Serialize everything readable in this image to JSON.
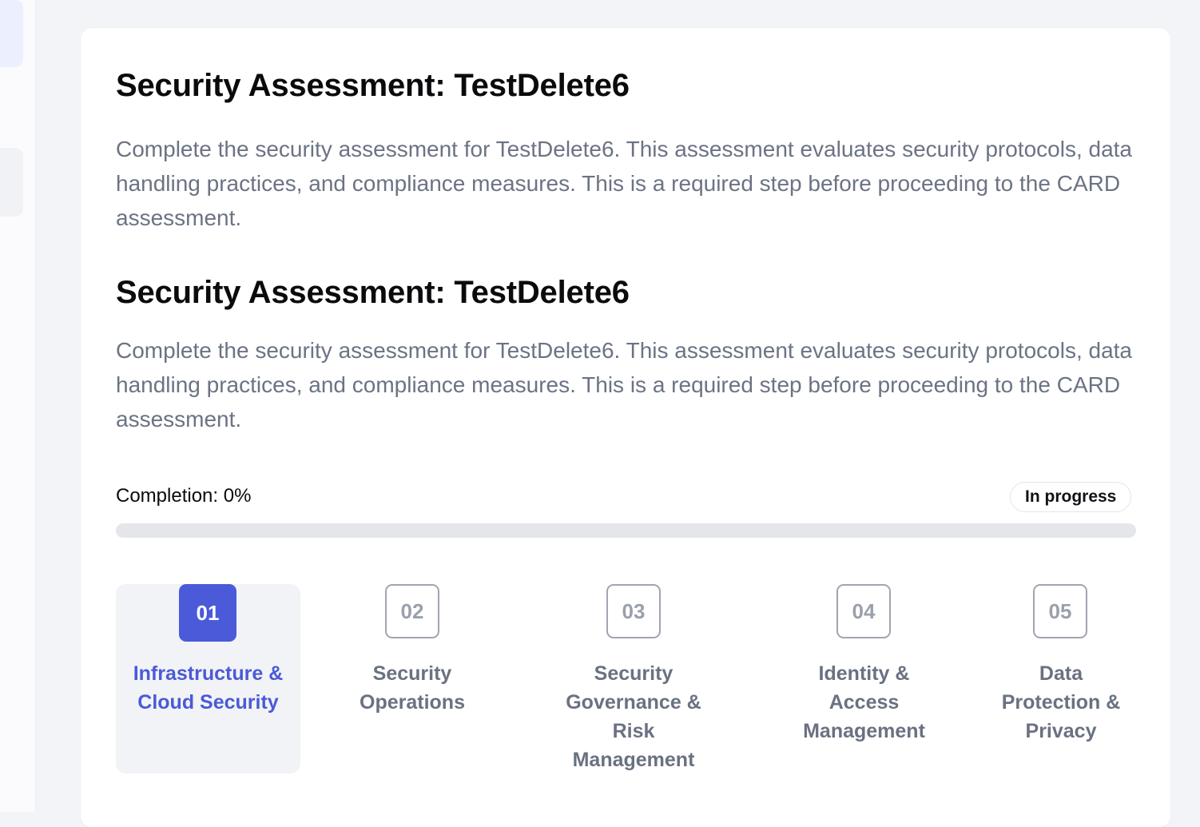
{
  "assessment": {
    "title": "Security Assessment: TestDelete6",
    "description": "Complete the security assessment for TestDelete6. This assessment evaluates security protocols, data handling practices, and compliance measures. This is a required step before proceeding to the CARD assessment.",
    "title_repeat": "Security Assessment: TestDelete6",
    "description_repeat": "Complete the security assessment for TestDelete6. This assessment evaluates security protocols, data handling practices, and compliance measures. This is a required step before proceeding to the CARD assessment."
  },
  "progress": {
    "label": "Completion: 0%",
    "value": 0,
    "status": "In progress"
  },
  "steps": [
    {
      "number": "01",
      "label": "Infrastructure & Cloud Security",
      "active": true
    },
    {
      "number": "02",
      "label": "Security Operations",
      "active": false
    },
    {
      "number": "03",
      "label": "Security Governance & Risk Management",
      "active": false
    },
    {
      "number": "04",
      "label": "Identity & Access Management",
      "active": false
    },
    {
      "number": "05",
      "label": "Data Protection & Privacy",
      "active": false
    }
  ],
  "colors": {
    "accent": "#4a5ad8",
    "step_inactive": "#6a7181",
    "text_muted": "#6b7384"
  }
}
